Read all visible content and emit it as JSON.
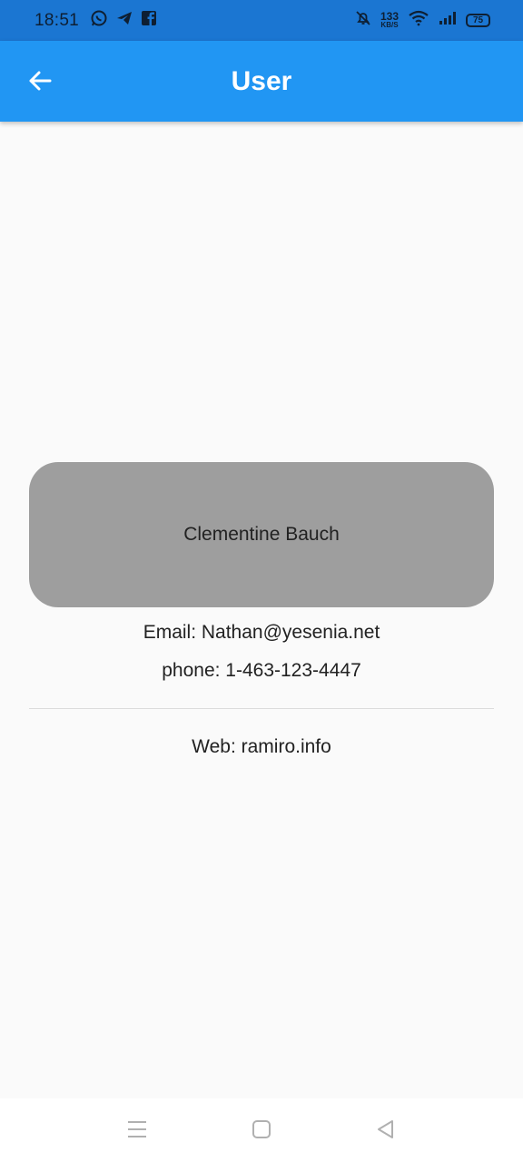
{
  "status_bar": {
    "time": "18:51",
    "net_speed_value": "133",
    "net_speed_unit": "KB/S",
    "battery": "75",
    "left_icons": [
      "whatsapp-icon",
      "telegram-icon",
      "facebook-icon"
    ],
    "right_icons": [
      "bell-off-icon",
      "wifi-icon",
      "signal-icon",
      "battery-icon"
    ]
  },
  "app_bar": {
    "title": "User",
    "back_icon": "arrow-left-icon",
    "background": "#2196f3"
  },
  "user": {
    "name": "Clementine Bauch",
    "email": "Email: Nathan@yesenia.net",
    "phone": "phone: 1-463-123-4447",
    "web": "Web: ramiro.info"
  },
  "nav_bar": {
    "icons": [
      "menu-icon",
      "home-square-icon",
      "back-triangle-icon"
    ]
  }
}
